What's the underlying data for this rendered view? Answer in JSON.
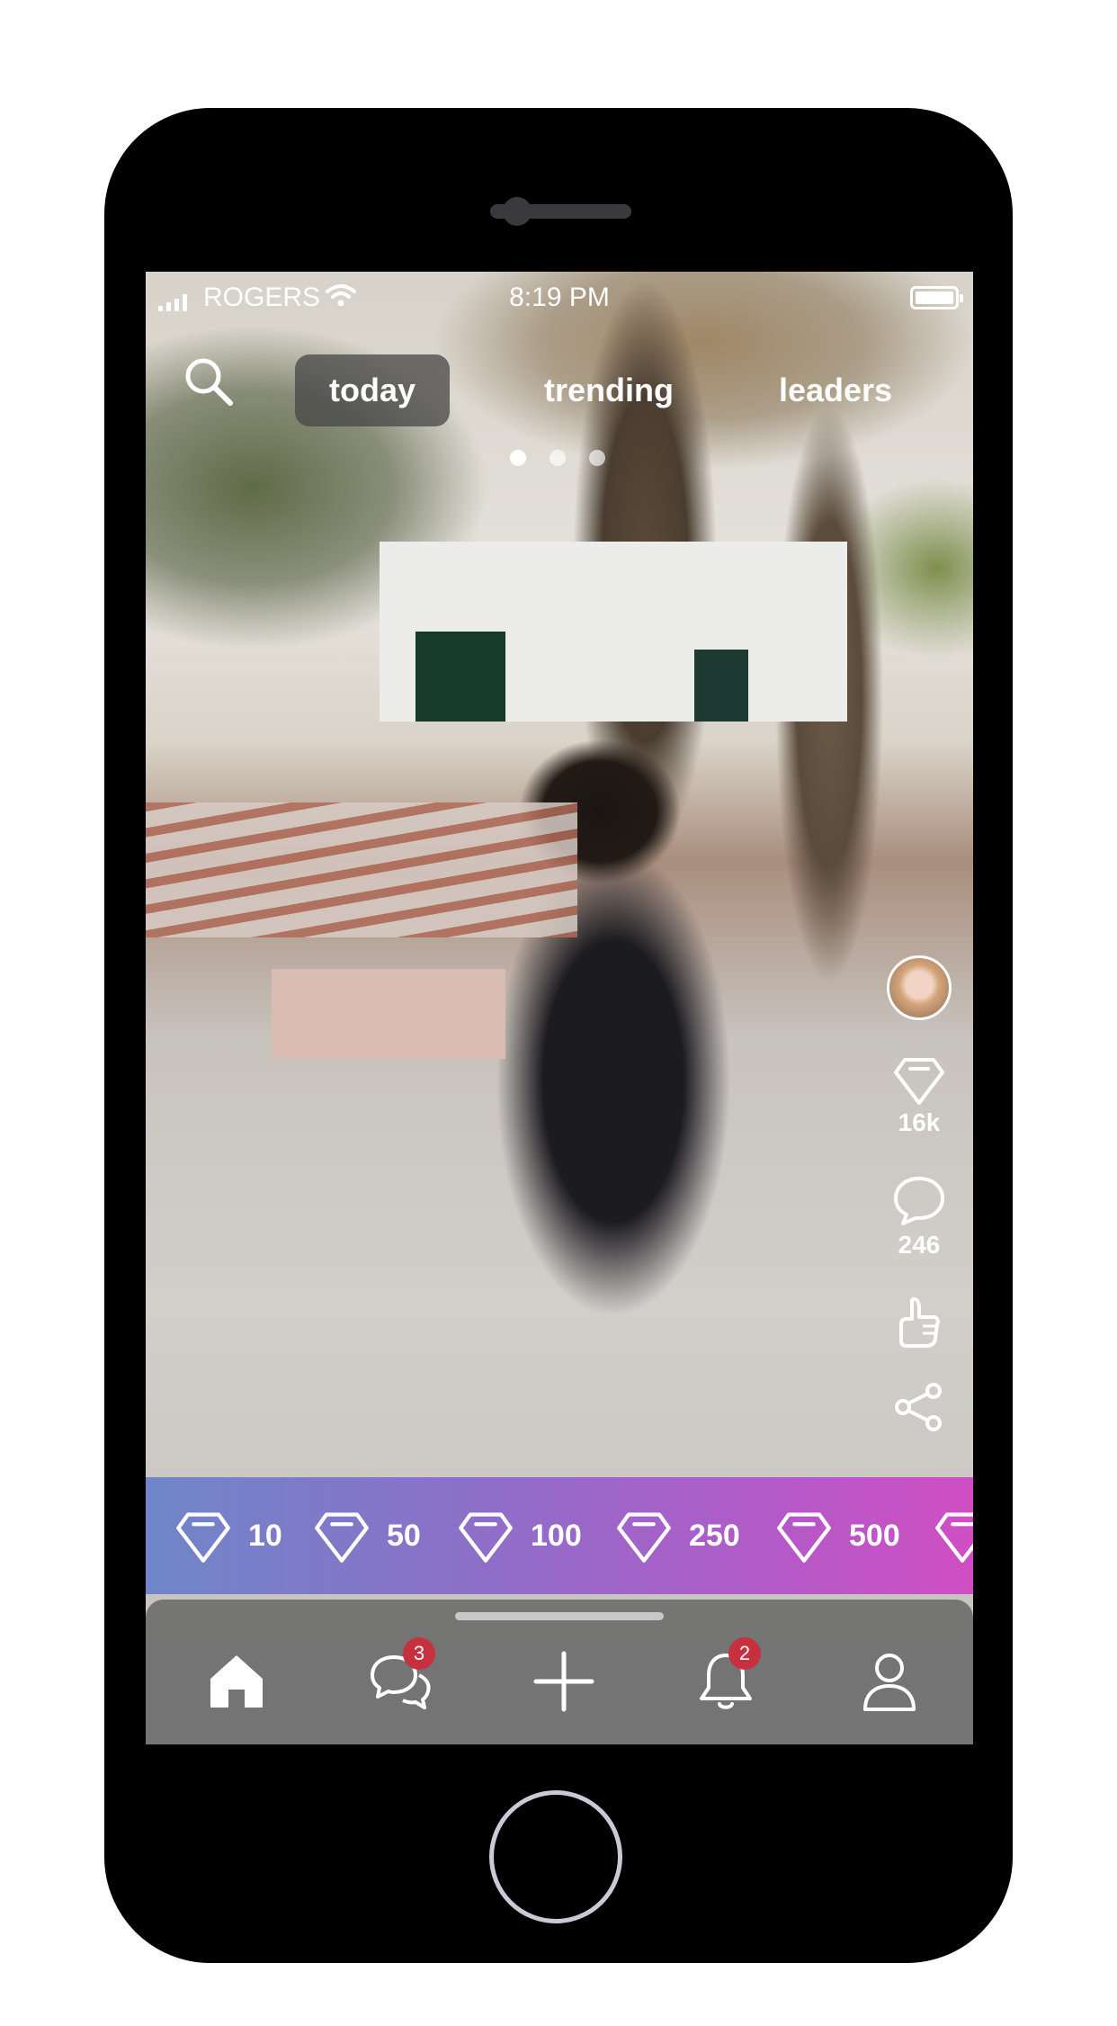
{
  "status_bar": {
    "carrier": "ROGERS",
    "time": "8:19 PM"
  },
  "top_nav": {
    "tabs": [
      {
        "label": "today",
        "active": true
      },
      {
        "label": "trending",
        "active": false
      },
      {
        "label": "leaders",
        "active": false
      }
    ],
    "page_dots": {
      "count": 3,
      "active_index": 0
    }
  },
  "post_actions": {
    "diamonds_count": "16k",
    "comments_count": "246"
  },
  "gift_bar": {
    "amounts": [
      "10",
      "50",
      "100",
      "250",
      "500"
    ]
  },
  "bottom_nav": {
    "items": [
      "home",
      "messages",
      "create",
      "notifications",
      "profile"
    ],
    "messages_badge": "3",
    "notifications_badge": "2"
  },
  "colors": {
    "gift_gradient_start": "#6f86c8",
    "gift_gradient_end": "#cf4ec3",
    "badge": "#c6303f",
    "active_tab_bg": "#464646"
  },
  "icons": [
    "search-icon",
    "wifi-icon",
    "battery-icon",
    "diamond-icon",
    "comment-icon",
    "thumbs-up-icon",
    "share-icon",
    "home-icon",
    "chat-icon",
    "plus-icon",
    "bell-icon",
    "user-icon"
  ]
}
